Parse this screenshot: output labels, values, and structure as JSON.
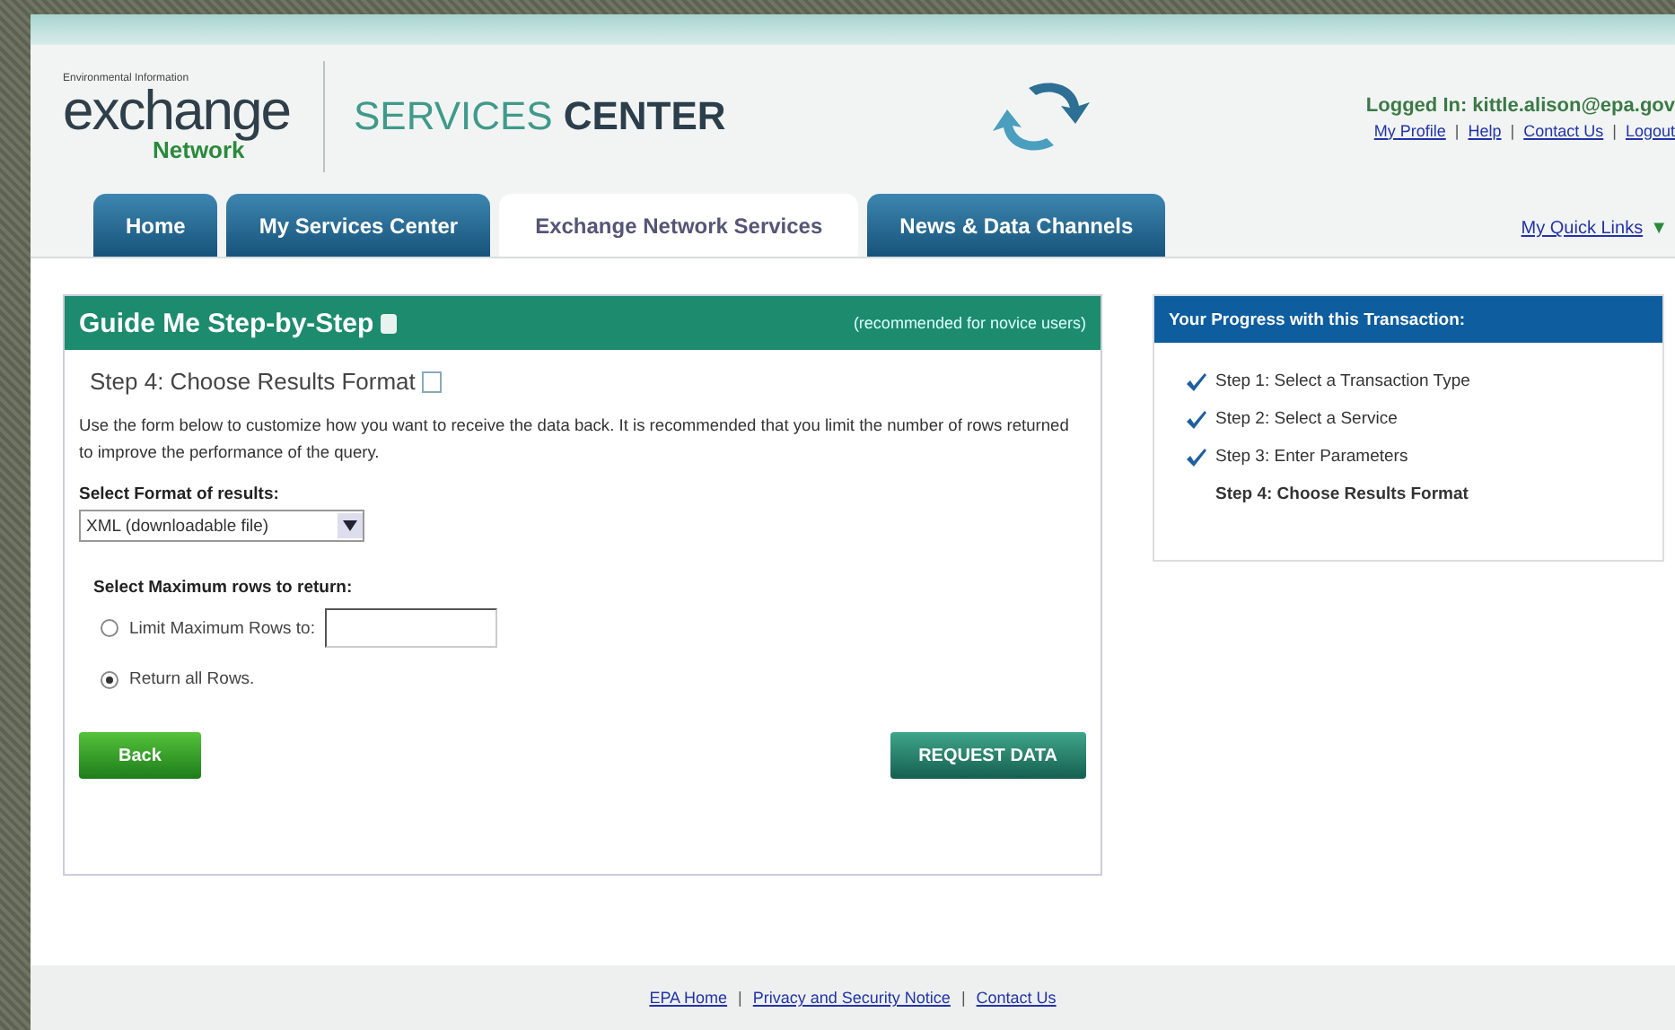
{
  "header": {
    "logo": {
      "caption": "Environmental Information",
      "word": "exchange",
      "sub": "Network"
    },
    "title_light": "SERVICES",
    "title_bold": "CENTER",
    "login": "Logged In: kittle.alison@epa.gov",
    "separator": "|",
    "links": [
      "My Profile",
      "Help",
      "Contact Us",
      "Logout"
    ]
  },
  "tabs": [
    {
      "label": "Home",
      "selected": false
    },
    {
      "label": "My Services Center",
      "selected": false
    },
    {
      "label": "Exchange Network Services",
      "selected": true
    },
    {
      "label": "News & Data Channels",
      "selected": false
    }
  ],
  "quick_links": {
    "label": "My Quick Links",
    "caret": "▼"
  },
  "guide": {
    "title": "Guide Me Step-by-Step",
    "note": "(recommended for novice users)",
    "step_title": "Step 4: Choose Results Format",
    "intro": "Use the form below to customize how you want to receive the data back. It is recommended that you limit the number of rows returned to improve the performance of the query.",
    "format_label": "Select Format of results:",
    "format_value": "XML (downloadable file)",
    "rows_label": "Select Maximum rows to return:",
    "options": [
      {
        "label": "Limit Maximum Rows to:",
        "selected": false,
        "kind": "field"
      },
      {
        "label": "Return all Rows.",
        "selected": true,
        "kind": "plain"
      }
    ],
    "back": "Back",
    "request": "REQUEST DATA"
  },
  "progress": {
    "title": "Your Progress with this Transaction:",
    "steps": [
      {
        "label": "Step 1: Select a Transaction Type",
        "checked": true
      },
      {
        "label": "Step 2: Select a Service",
        "checked": true
      },
      {
        "label": "Step 3: Enter Parameters",
        "checked": true
      },
      {
        "label": "Step 4: Choose Results Format",
        "checked": false
      }
    ]
  },
  "footer": {
    "separator": "|",
    "links": [
      "EPA Home",
      "Privacy and Security Notice",
      "Contact Us"
    ]
  }
}
